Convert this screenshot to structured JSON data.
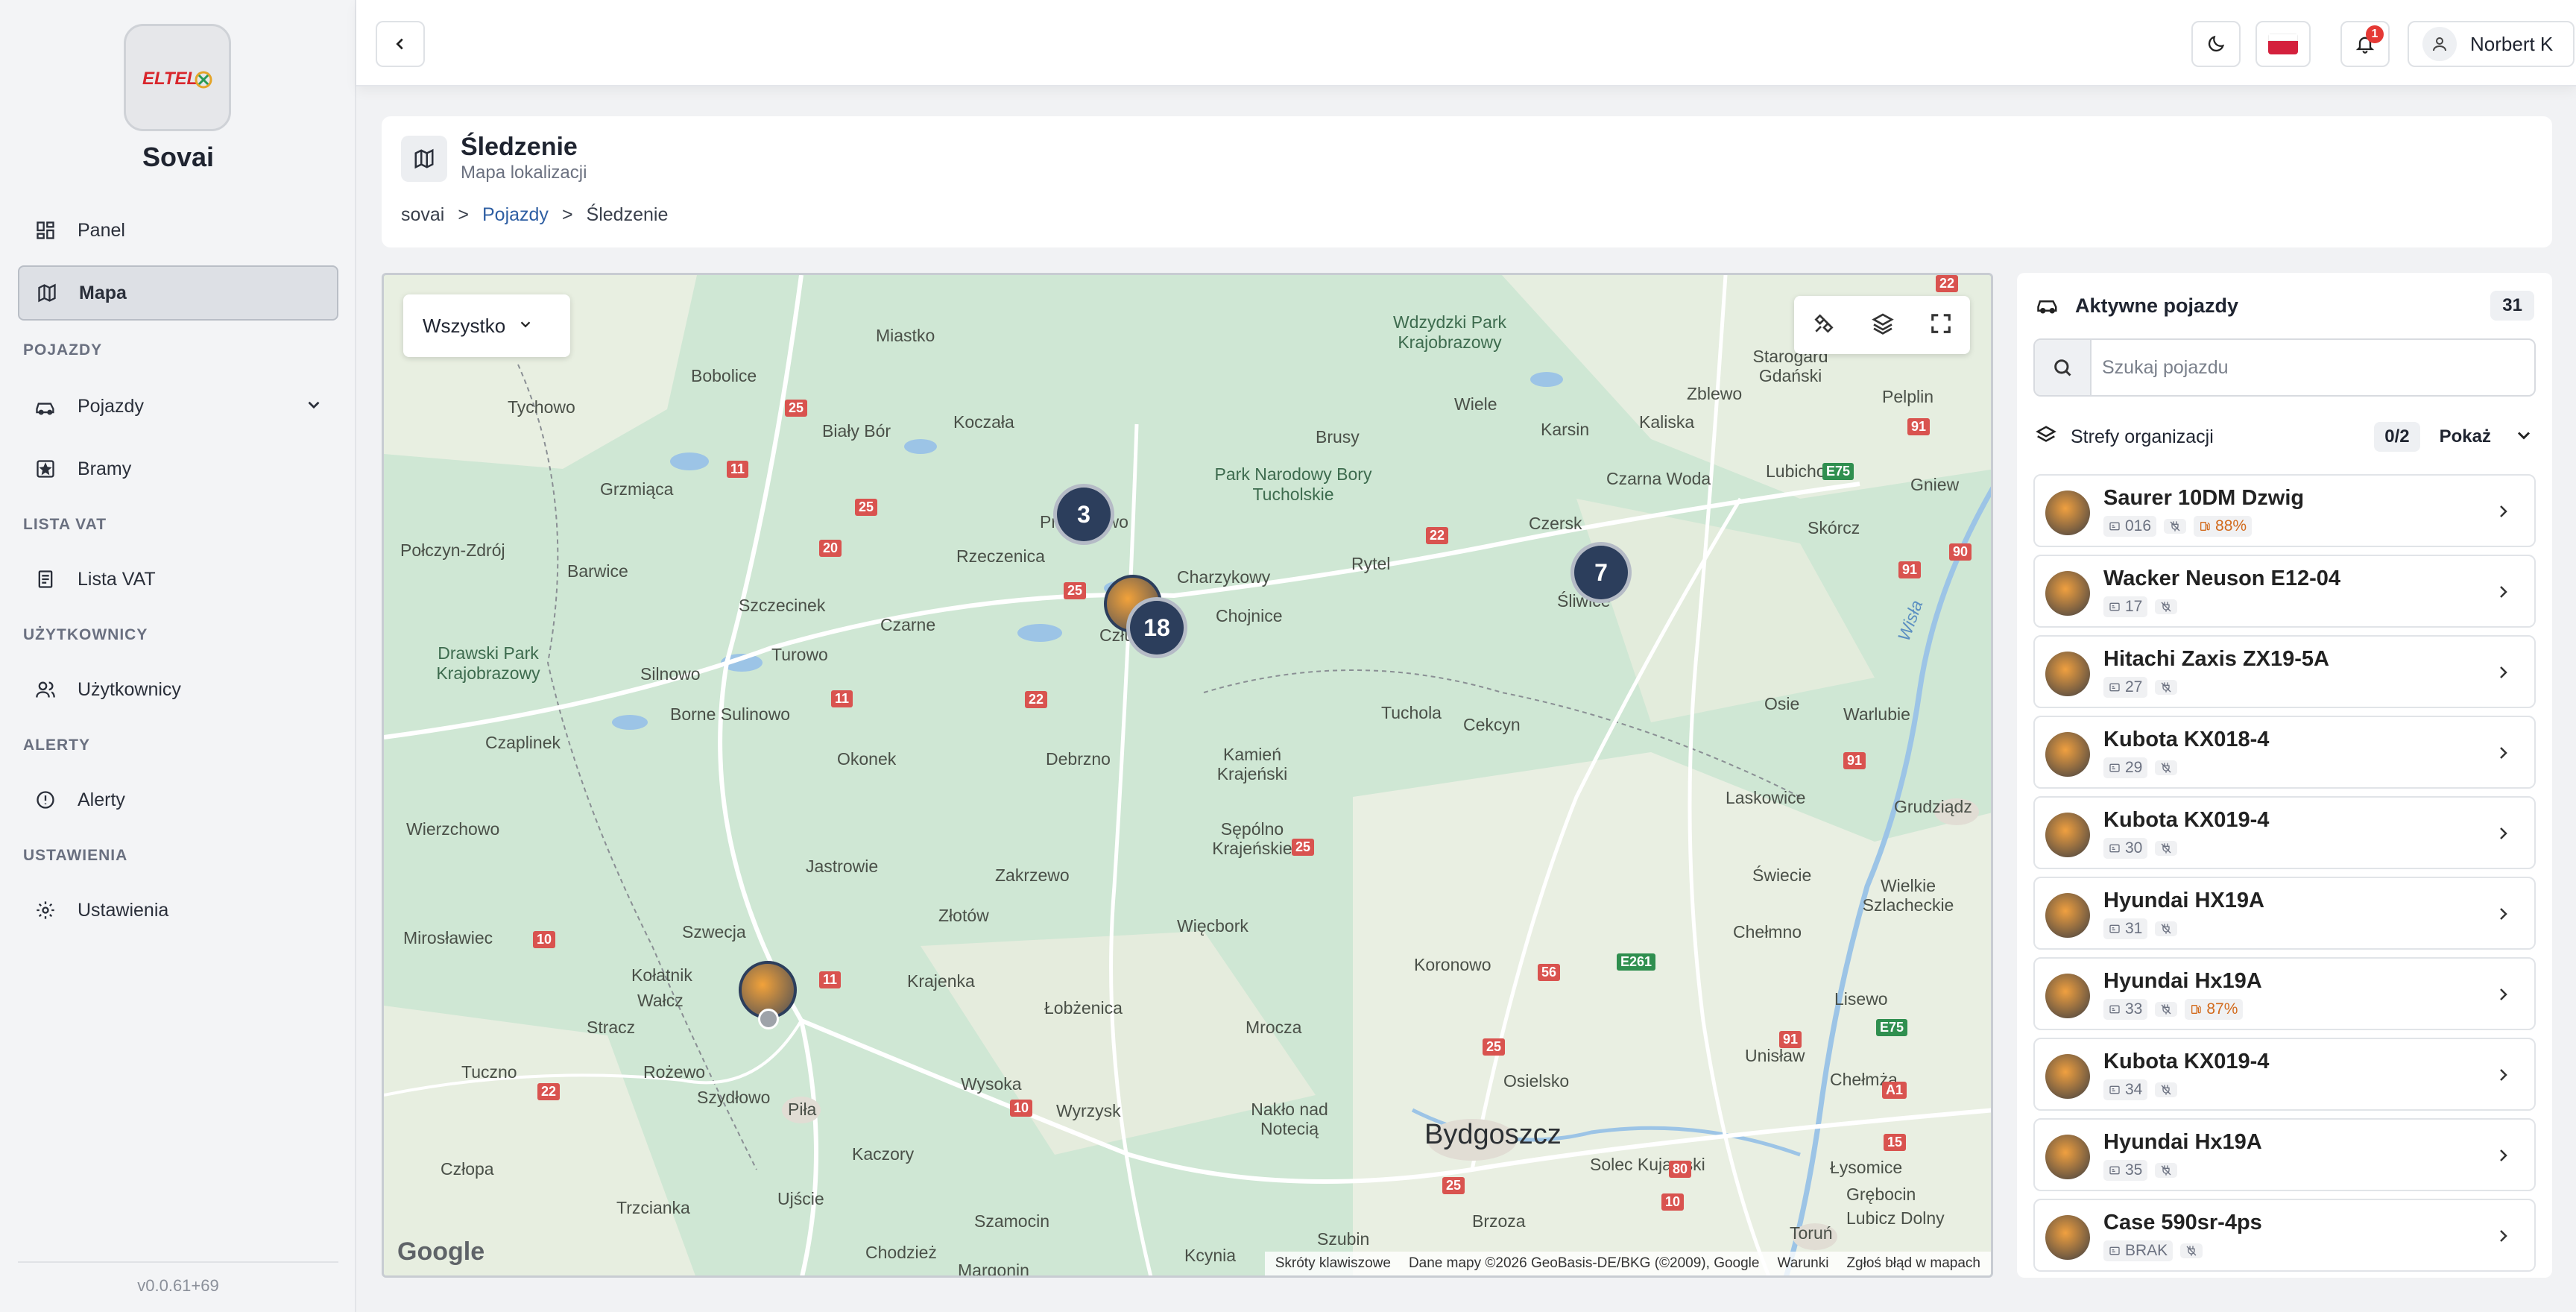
{
  "app": {
    "name": "Sovai",
    "logo_text": "ELTEL",
    "version": "v0.0.61+69"
  },
  "sidebar": {
    "items": [
      {
        "label": "Panel",
        "icon": "dashboard-icon"
      },
      {
        "label": "Mapa",
        "icon": "map-icon",
        "active": true
      },
      {
        "section": "POJAZDY"
      },
      {
        "label": "Pojazdy",
        "icon": "car-icon",
        "expandable": true
      },
      {
        "label": "Bramy",
        "icon": "gate-icon"
      },
      {
        "section": "LISTA VAT"
      },
      {
        "label": "Lista VAT",
        "icon": "document-icon"
      },
      {
        "section": "UŻYTKOWNICY"
      },
      {
        "label": "Użytkownicy",
        "icon": "users-icon"
      },
      {
        "section": "ALERTY"
      },
      {
        "label": "Alerty",
        "icon": "alert-icon"
      },
      {
        "section": "USTAWIENIA"
      },
      {
        "label": "Ustawienia",
        "icon": "gear-icon"
      }
    ]
  },
  "topbar": {
    "notifications_count": "1",
    "user_name": "Norbert K",
    "language_flag": "PL"
  },
  "page": {
    "title": "Śledzenie",
    "subtitle": "Mapa lokalizacji",
    "breadcrumb": [
      "sovai",
      ">",
      "Pojazdy",
      ">",
      "Śledzenie"
    ]
  },
  "map": {
    "filter_value": "Wszystko",
    "clusters": [
      {
        "count": "3"
      },
      {
        "count": "18"
      },
      {
        "count": "7"
      }
    ],
    "places": [
      "Miastko",
      "Bobolice",
      "Tychowo",
      "Biały Bór",
      "Koczała",
      "Grzmiąca",
      "Połczyn-Zdrój",
      "Barwice",
      "Szczecinek",
      "Przechlewo",
      "Rzeczenica",
      "Czarne",
      "Turowo",
      "Silnowo",
      "Borne Sulinowo",
      "Czaplinek",
      "Okonek",
      "Debrzno",
      "Człuchów",
      "Charzykowy",
      "Chojnice",
      "Rytel",
      "Brusy",
      "Wiele",
      "Karsin",
      "Zblewo",
      "Kaliska",
      "Lubichowo",
      "Czarna Woda",
      "Czersk",
      "Skórcz",
      "Śliwice",
      "Osie",
      "Warlubie",
      "Pelplin",
      "Gniew",
      "Starogard Gdański",
      "Tuchola",
      "Cekcyn",
      "Kamień Krajeński",
      "Sępólno Krajeńskie",
      "Jastrowie",
      "Zakrzewo",
      "Złotów",
      "Więcbork",
      "Szwecja",
      "Wierzchowo",
      "Mirosławiec",
      "Kołatnik",
      "Wałcz",
      "Krajenka",
      "Łobżenica",
      "Mrocza",
      "Koronowo",
      "Laskowice",
      "Świecie",
      "Grudziądz",
      "Wielkie Szlacheckie",
      "Chełmno",
      "Lisewo",
      "Unisław",
      "Chełmża",
      "Osielsko",
      "Bydgoszcz",
      "Solec Kujawski",
      "Nakło nad Notecią",
      "Wyrzysk",
      "Wysoka",
      "Piła",
      "Kaczory",
      "Ujście",
      "Szamocin",
      "Chodzież",
      "Margonin",
      "Szubin",
      "Kcynia",
      "Brzoza",
      "Toruń",
      "Łysomice",
      "Grębocin",
      "Lubicz Dolny",
      "Tuczno",
      "Rożewo",
      "Szydłowo",
      "Człopa",
      "Trzcianka",
      "Stracz"
    ],
    "parks": [
      "Wdzydzki Park Krajobrazowy",
      "Park Narodowy Bory Tucholskie",
      "Drawski Park Krajobrazowy"
    ],
    "river": "Wisła",
    "google_logo": "Google",
    "attribution": [
      "Skróty klawiszowe",
      "Dane mapy ©2026 GeoBasis-DE/BKG (©2009), Google",
      "Warunki",
      "Zgłoś błąd w mapach"
    ]
  },
  "panel": {
    "title": "Aktywne pojazdy",
    "count": "31",
    "search_placeholder": "Szukaj pojazdu",
    "zones_label": "Strefy organizacji",
    "zones_count": "0/2",
    "zones_show": "Pokaż",
    "vehicles": [
      {
        "name": "Saurer 10DM Dzwig",
        "id": "016",
        "fuel": "88%"
      },
      {
        "name": "Wacker Neuson E12-04",
        "id": "17",
        "fuel": ""
      },
      {
        "name": "Hitachi Zaxis ZX19-5A",
        "id": "27",
        "fuel": ""
      },
      {
        "name": "Kubota KX018-4",
        "id": "29",
        "fuel": ""
      },
      {
        "name": "Kubota KX019-4",
        "id": "30",
        "fuel": ""
      },
      {
        "name": "Hyundai HX19A",
        "id": "31",
        "fuel": ""
      },
      {
        "name": "Hyundai Hx19A",
        "id": "33",
        "fuel": "87%"
      },
      {
        "name": "Kubota KX019-4",
        "id": "34",
        "fuel": ""
      },
      {
        "name": "Hyundai Hx19A",
        "id": "35",
        "fuel": ""
      },
      {
        "name": "Case 590sr-4ps",
        "id": "BRAK",
        "fuel": ""
      }
    ]
  },
  "colors": {
    "cluster": "#2c3e5c",
    "accent": "#2f5fa3",
    "map_bg": "#cfe7d4",
    "notification": "#e53935"
  }
}
